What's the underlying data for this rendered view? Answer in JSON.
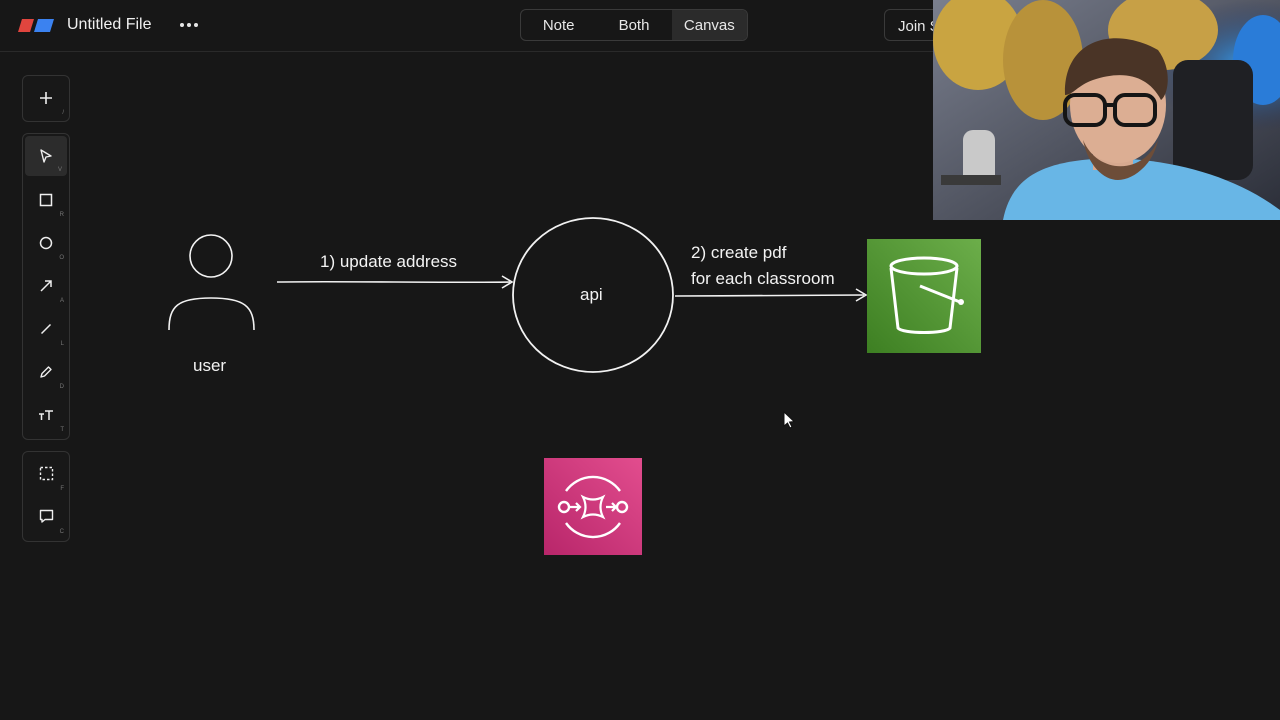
{
  "app": {
    "file_title": "Untitled File",
    "more_icon": "more-horizontal-icon",
    "view_modes": [
      "Note",
      "Both",
      "Canvas"
    ],
    "active_view_mode": "Canvas",
    "join_label": "Join S",
    "accent": "#4a8cf0"
  },
  "toolbar": {
    "top": [
      {
        "name": "add",
        "icon": "plus-icon",
        "key": "/"
      }
    ],
    "main": [
      {
        "name": "select",
        "icon": "cursor-arrow-icon",
        "key": "V",
        "active": true
      },
      {
        "name": "rectangle",
        "icon": "square-icon",
        "key": "R"
      },
      {
        "name": "ellipse",
        "icon": "circle-icon",
        "key": "O"
      },
      {
        "name": "arrow",
        "icon": "arrow-icon",
        "key": "A"
      },
      {
        "name": "line",
        "icon": "line-icon",
        "key": "L"
      },
      {
        "name": "pencil",
        "icon": "pencil-icon",
        "key": "D"
      },
      {
        "name": "text",
        "icon": "text-icon",
        "key": "T"
      }
    ],
    "bottom": [
      {
        "name": "frame",
        "icon": "frame-icon",
        "key": "F"
      },
      {
        "name": "comment",
        "icon": "comment-icon",
        "key": "C"
      }
    ]
  },
  "diagram": {
    "user_label": "user",
    "arrow1_label": "1) update address",
    "api_label": "api",
    "arrow2_label_line1": "2) create pdf",
    "arrow2_label_line2": "for each classroom",
    "s3_icon": "s3-bucket-icon",
    "s3_color": "#4f9a35",
    "sqs_icon": "sqs-queue-icon",
    "sqs_color": "#d63a7c"
  },
  "webcam": {
    "description_icon": "webcam-feed"
  }
}
